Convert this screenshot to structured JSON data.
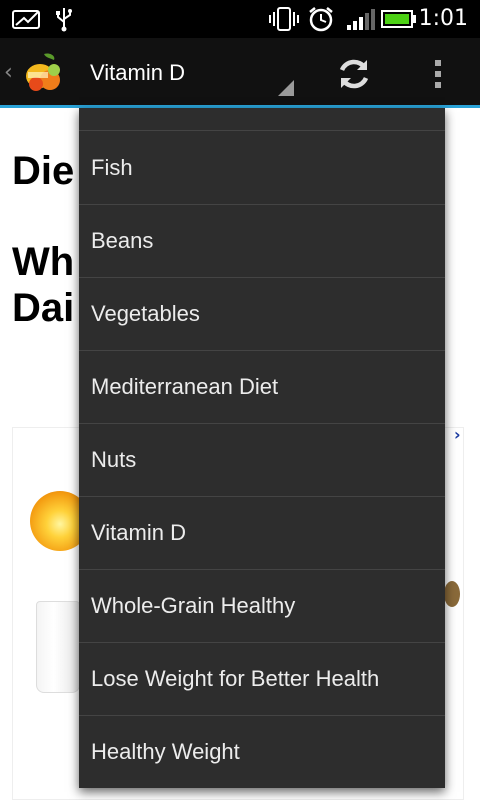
{
  "status_bar": {
    "time": "1:01",
    "icons": [
      "image-icon",
      "usb-icon",
      "vibrate-icon",
      "alarm-icon",
      "signal-icon",
      "battery-icon"
    ]
  },
  "action_bar": {
    "nav_title": "Vitamin D",
    "accent_color": "#2aa3d8"
  },
  "page": {
    "heading_1": "Die",
    "heading_2_line1": "Wh",
    "heading_2_line2": "Dai"
  },
  "dropdown": {
    "items": [
      "",
      "Fish",
      "Beans",
      "Vegetables",
      "Mediterranean Diet",
      "Nuts",
      "Vitamin D",
      "Whole-Grain Healthy",
      "Lose Weight for Better Health",
      "Healthy Weight"
    ]
  }
}
